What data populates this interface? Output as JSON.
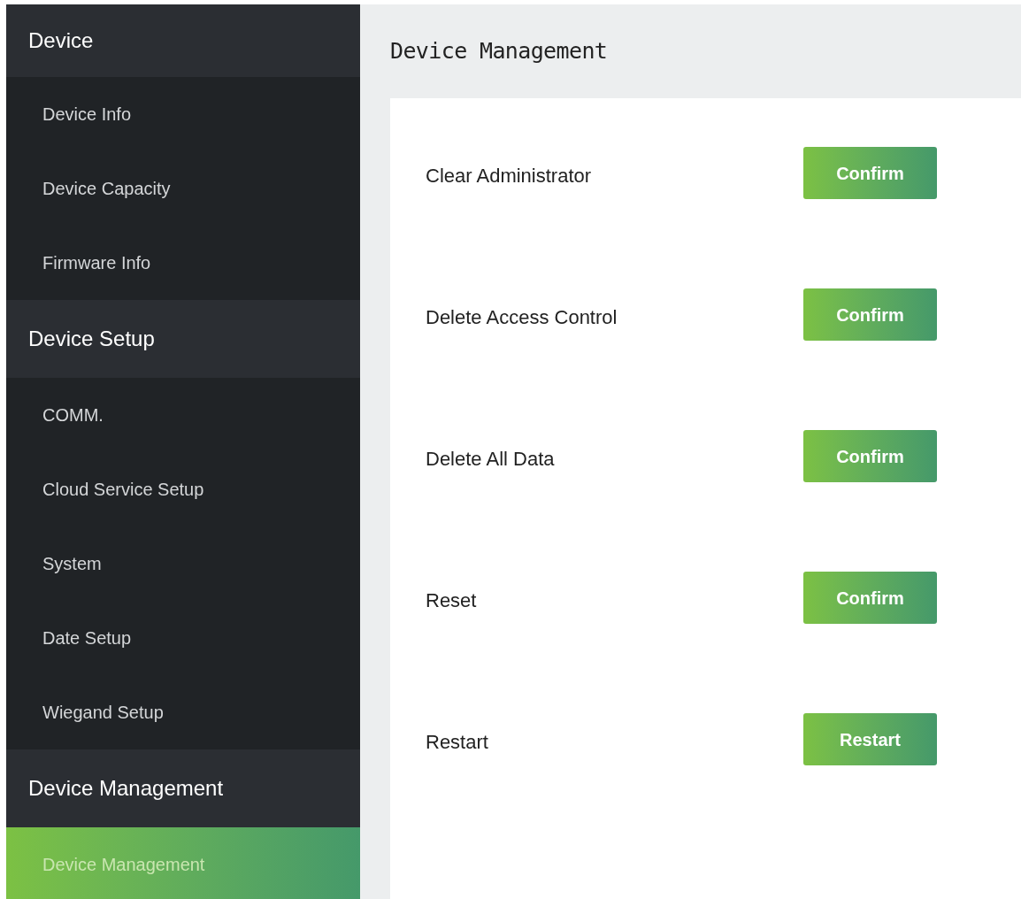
{
  "sidebar": {
    "sections": [
      {
        "title": "Device",
        "items": [
          {
            "label": "Device Info",
            "selected": false
          },
          {
            "label": "Device Capacity",
            "selected": false
          },
          {
            "label": "Firmware Info",
            "selected": false
          }
        ]
      },
      {
        "title": "Device Setup",
        "items": [
          {
            "label": "COMM.",
            "selected": false
          },
          {
            "label": "Cloud Service Setup",
            "selected": false
          },
          {
            "label": "System",
            "selected": false
          },
          {
            "label": "Date Setup",
            "selected": false
          },
          {
            "label": "Wiegand Setup",
            "selected": false
          }
        ]
      },
      {
        "title": "Device Management",
        "items": [
          {
            "label": "Device Management",
            "selected": true
          }
        ]
      }
    ]
  },
  "page": {
    "title": "Device Management",
    "actions": [
      {
        "label": "Clear Administrator",
        "button": "Confirm"
      },
      {
        "label": "Delete Access Control",
        "button": "Confirm"
      },
      {
        "label": "Delete All Data",
        "button": "Confirm"
      },
      {
        "label": "Reset",
        "button": "Confirm"
      },
      {
        "label": "Restart",
        "button": "Restart"
      }
    ]
  }
}
